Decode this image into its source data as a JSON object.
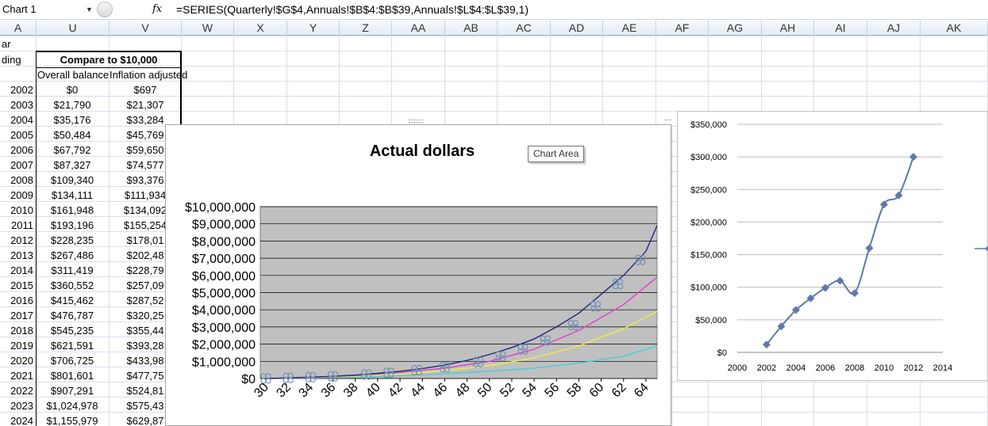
{
  "formula_bar": {
    "name_box": "Chart 1",
    "fx": "fx",
    "formula": "=SERIES(Quarterly!$G$4,Annuals!$B$4:$B$39,Annuals!$L$4:$L$39,1)"
  },
  "columns": [
    "A",
    "U",
    "V",
    "W",
    "X",
    "Y",
    "Z",
    "AA",
    "AB",
    "AC",
    "AD",
    "AE",
    "AF",
    "AG",
    "AH",
    "AI",
    "AJ",
    "AK"
  ],
  "header_cells": {
    "a_row1": "ar",
    "a_row2": "ding",
    "compare": "Compare to $10,000",
    "u_sub": "Overall balance",
    "v_sub": "Inflation adjusted"
  },
  "rows": [
    {
      "year": "2002",
      "balance": "$0",
      "adjusted": "$697"
    },
    {
      "year": "2003",
      "balance": "$21,790",
      "adjusted": "$21,307"
    },
    {
      "year": "2004",
      "balance": "$35,176",
      "adjusted": "$33,284"
    },
    {
      "year": "2005",
      "balance": "$50,484",
      "adjusted": "$45,769"
    },
    {
      "year": "2006",
      "balance": "$67,792",
      "adjusted": "$59,650"
    },
    {
      "year": "2007",
      "balance": "$87,327",
      "adjusted": "$74,577"
    },
    {
      "year": "2008",
      "balance": "$109,340",
      "adjusted": "$93,376"
    },
    {
      "year": "2009",
      "balance": "$134,111",
      "adjusted": "$111,934"
    },
    {
      "year": "2010",
      "balance": "$161,948",
      "adjusted": "$134,092"
    },
    {
      "year": "2011",
      "balance": "$193,196",
      "adjusted": "$155,254"
    },
    {
      "year": "2012",
      "balance": "$228,235",
      "adjusted": "$178,01"
    },
    {
      "year": "2013",
      "balance": "$267,486",
      "adjusted": "$202,48"
    },
    {
      "year": "2014",
      "balance": "$311,419",
      "adjusted": "$228,79"
    },
    {
      "year": "2015",
      "balance": "$360,552",
      "adjusted": "$257,09"
    },
    {
      "year": "2016",
      "balance": "$415,462",
      "adjusted": "$287,52"
    },
    {
      "year": "2017",
      "balance": "$476,787",
      "adjusted": "$320,25"
    },
    {
      "year": "2018",
      "balance": "$545,235",
      "adjusted": "$355,44"
    },
    {
      "year": "2019",
      "balance": "$621,591",
      "adjusted": "$393,28"
    },
    {
      "year": "2020",
      "balance": "$706,725",
      "adjusted": "$433,98"
    },
    {
      "year": "2021",
      "balance": "$801,601",
      "adjusted": "$477,75"
    },
    {
      "year": "2022",
      "balance": "$907,291",
      "adjusted": "$524,81"
    },
    {
      "year": "2023",
      "balance": "$1,024,978",
      "adjusted": "$575,43"
    },
    {
      "year": "2024",
      "balance": "$1,155,979",
      "adjusted": "$629,87"
    }
  ],
  "tooltip": "Chart Area",
  "colors": {
    "plot_bg": "#c0c0c0",
    "navy": "#1f2a7a",
    "magenta": "#e040c8",
    "yellow": "#f0f040",
    "cyan": "#40d0e0",
    "side_line": "#5f7aa8",
    "grid_line": "#d9dfe8"
  },
  "chart_data": [
    {
      "type": "line",
      "title": "Actual dollars",
      "ylim": [
        0,
        10000000
      ],
      "y_ticks": [
        "$0",
        "$1,000,000",
        "$2,000,000",
        "$3,000,000",
        "$4,000,000",
        "$5,000,000",
        "$6,000,000",
        "$7,000,000",
        "$8,000,000",
        "$9,000,000",
        "$10,000,000"
      ],
      "x_ticks": [
        "30",
        "32",
        "34",
        "36",
        "38",
        "40",
        "42",
        "44",
        "46",
        "48",
        "50",
        "52",
        "54",
        "56",
        "58",
        "60",
        "62",
        "64"
      ],
      "xlim": [
        29.5,
        65
      ],
      "series": [
        {
          "color": "navy",
          "x": [
            30,
            32,
            34,
            36,
            38,
            40,
            42,
            44,
            46,
            48,
            50,
            52,
            54,
            56,
            58,
            60,
            62,
            64,
            65
          ],
          "y": [
            0,
            30000,
            80000,
            130000,
            200000,
            300000,
            420000,
            580000,
            780000,
            1050000,
            1400000,
            1800000,
            2300000,
            3000000,
            3800000,
            4900000,
            6000000,
            7400000,
            8900000
          ]
        },
        {
          "color": "magenta",
          "x": [
            30,
            34,
            38,
            42,
            46,
            50,
            54,
            58,
            62,
            65
          ],
          "y": [
            0,
            60000,
            170000,
            350000,
            600000,
            1000000,
            1700000,
            2800000,
            4300000,
            5900000
          ]
        },
        {
          "color": "yellow",
          "x": [
            30,
            34,
            38,
            42,
            46,
            50,
            54,
            58,
            62,
            65
          ],
          "y": [
            0,
            50000,
            130000,
            260000,
            450000,
            750000,
            1200000,
            1900000,
            2900000,
            3900000
          ]
        },
        {
          "color": "cyan",
          "x": [
            30,
            34,
            38,
            42,
            46,
            50,
            54,
            58,
            62,
            65
          ],
          "y": [
            0,
            30000,
            80000,
            160000,
            280000,
            420000,
            600000,
            900000,
            1300000,
            1900000
          ]
        }
      ],
      "markers": {
        "x": [
          30,
          32,
          34,
          36,
          39,
          41,
          43.5,
          46,
          49,
          51,
          53,
          55,
          57.5,
          59.5,
          61.5,
          63.5
        ],
        "y": [
          0,
          30000,
          80000,
          130000,
          230000,
          330000,
          480000,
          660000,
          950000,
          1300000,
          1700000,
          2200000,
          3100000,
          4200000,
          5500000,
          6900000
        ]
      }
    },
    {
      "type": "line",
      "x": [
        2002,
        2003,
        2004,
        2005,
        2006,
        2007,
        2008,
        2009,
        2010,
        2011,
        2012
      ],
      "y": [
        12000,
        40000,
        65000,
        83000,
        99000,
        110000,
        91000,
        160000,
        227000,
        241000,
        300000
      ],
      "xlim": [
        2000,
        2014
      ],
      "ylim": [
        0,
        350000
      ],
      "x_ticks": [
        "2000",
        "2002",
        "2004",
        "2006",
        "2008",
        "2010",
        "2012",
        "2014"
      ],
      "y_ticks": [
        "$0",
        "$50,000",
        "$100,000",
        "$150,000",
        "$200,000",
        "$250,000",
        "$300,000",
        "$350,000"
      ]
    }
  ]
}
